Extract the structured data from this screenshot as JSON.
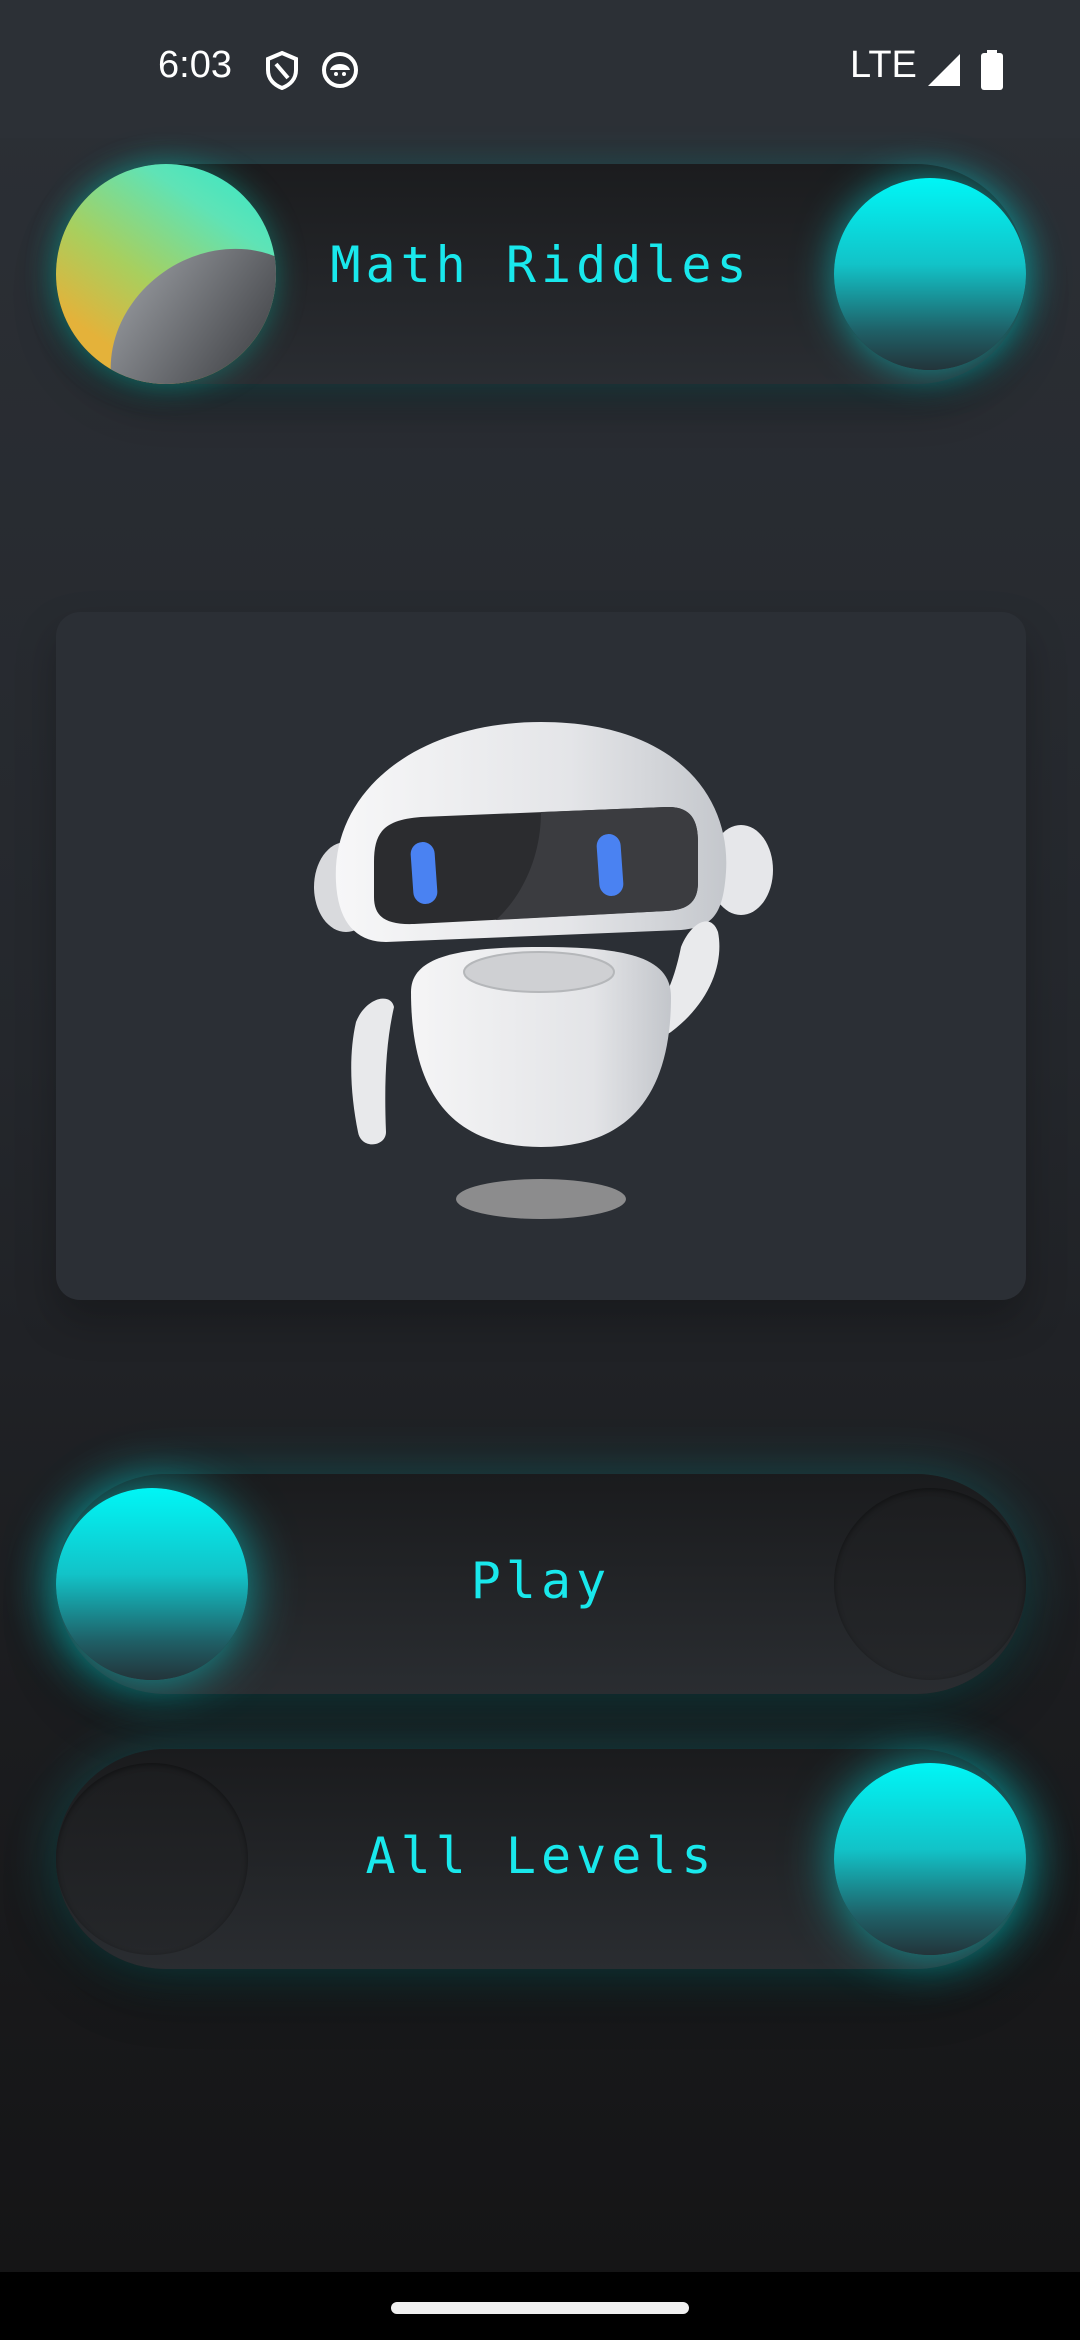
{
  "status_bar": {
    "time": "6:03",
    "network": "LTE",
    "icons": [
      "shield-icon",
      "face-icon",
      "signal-icon",
      "battery-icon"
    ]
  },
  "header": {
    "title": "Math Riddles"
  },
  "card": {
    "illustration": "robot-icon"
  },
  "buttons": {
    "play_label": "Play",
    "levels_label": "All Levels"
  },
  "colors": {
    "accent": "#19e8ec",
    "background": "#24272c",
    "card": "#2b2f35"
  }
}
